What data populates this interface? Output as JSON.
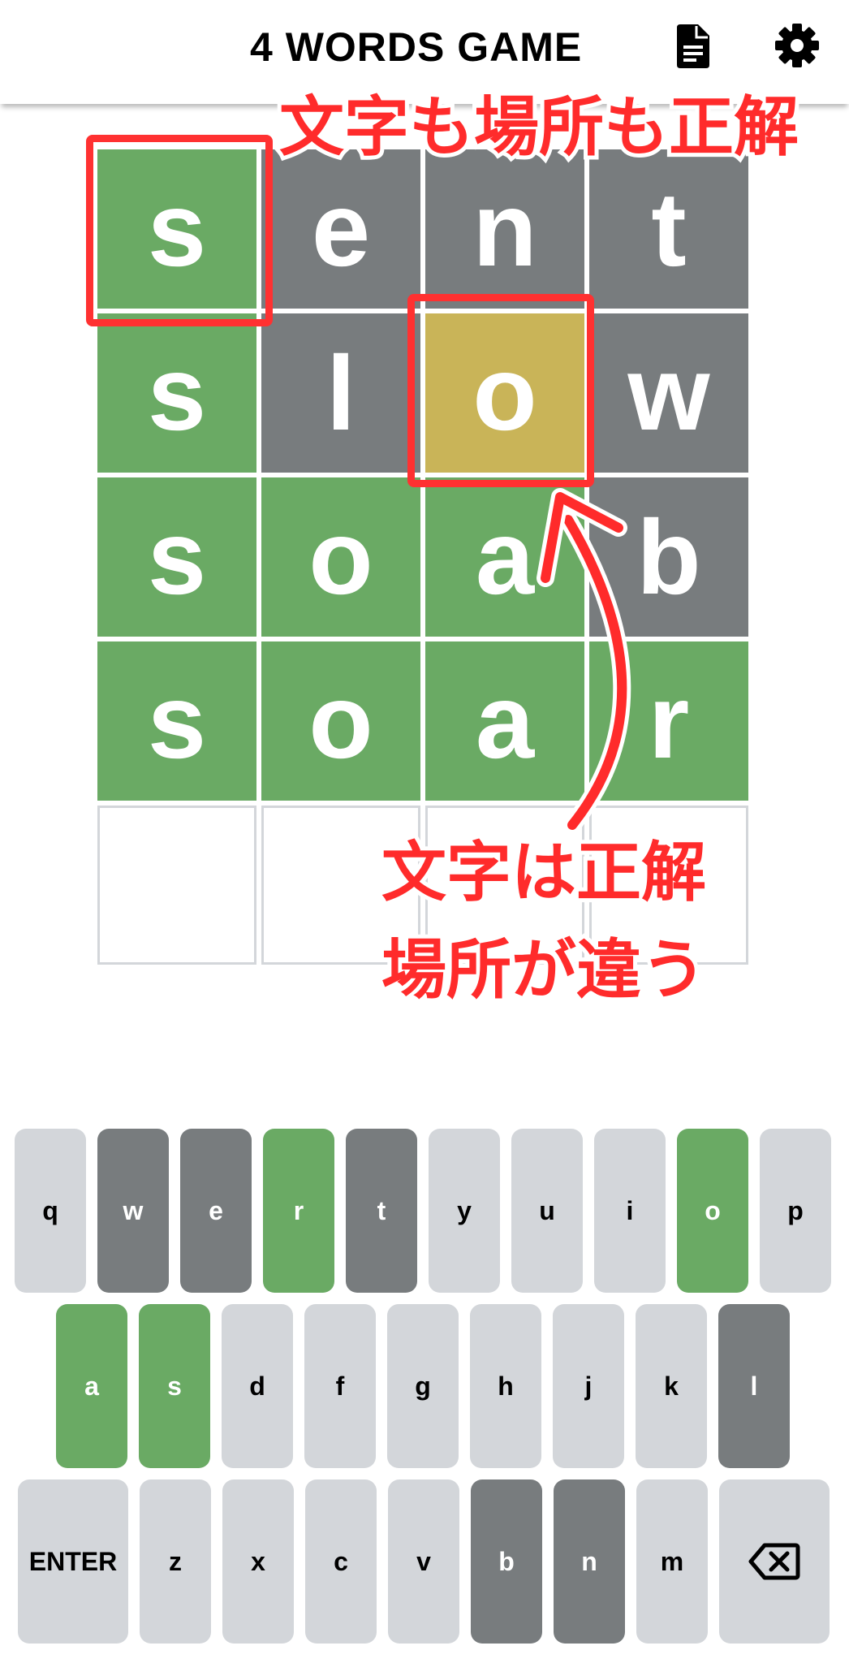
{
  "header": {
    "title": "4 WORDS GAME",
    "icons": {
      "help": "document-icon",
      "settings": "gear-icon"
    }
  },
  "board": {
    "rows": [
      [
        {
          "letter": "s",
          "state": "green"
        },
        {
          "letter": "e",
          "state": "gray"
        },
        {
          "letter": "n",
          "state": "gray"
        },
        {
          "letter": "t",
          "state": "gray"
        }
      ],
      [
        {
          "letter": "s",
          "state": "green"
        },
        {
          "letter": "l",
          "state": "gray"
        },
        {
          "letter": "o",
          "state": "yellow"
        },
        {
          "letter": "w",
          "state": "gray"
        }
      ],
      [
        {
          "letter": "s",
          "state": "green"
        },
        {
          "letter": "o",
          "state": "green"
        },
        {
          "letter": "a",
          "state": "green"
        },
        {
          "letter": "b",
          "state": "gray"
        }
      ],
      [
        {
          "letter": "s",
          "state": "green"
        },
        {
          "letter": "o",
          "state": "green"
        },
        {
          "letter": "a",
          "state": "green"
        },
        {
          "letter": "r",
          "state": "green"
        }
      ],
      [
        {
          "letter": "",
          "state": "empty"
        },
        {
          "letter": "",
          "state": "empty"
        },
        {
          "letter": "",
          "state": "empty"
        },
        {
          "letter": "",
          "state": "empty"
        }
      ]
    ]
  },
  "annotations": {
    "correct_position": "文字も場所も正解",
    "wrong_position_line1": "文字は正解",
    "wrong_position_line2": "場所が違う"
  },
  "keyboard": {
    "row1": [
      {
        "label": "q",
        "state": "default"
      },
      {
        "label": "w",
        "state": "gray"
      },
      {
        "label": "e",
        "state": "gray"
      },
      {
        "label": "r",
        "state": "green"
      },
      {
        "label": "t",
        "state": "gray"
      },
      {
        "label": "y",
        "state": "default"
      },
      {
        "label": "u",
        "state": "default"
      },
      {
        "label": "i",
        "state": "default"
      },
      {
        "label": "o",
        "state": "green"
      },
      {
        "label": "p",
        "state": "default"
      }
    ],
    "row2": [
      {
        "label": "a",
        "state": "green"
      },
      {
        "label": "s",
        "state": "green"
      },
      {
        "label": "d",
        "state": "default"
      },
      {
        "label": "f",
        "state": "default"
      },
      {
        "label": "g",
        "state": "default"
      },
      {
        "label": "h",
        "state": "default"
      },
      {
        "label": "j",
        "state": "default"
      },
      {
        "label": "k",
        "state": "default"
      },
      {
        "label": "l",
        "state": "gray"
      }
    ],
    "row3": [
      {
        "label": "ENTER",
        "state": "default"
      },
      {
        "label": "z",
        "state": "default"
      },
      {
        "label": "x",
        "state": "default"
      },
      {
        "label": "c",
        "state": "default"
      },
      {
        "label": "v",
        "state": "default"
      },
      {
        "label": "b",
        "state": "gray"
      },
      {
        "label": "n",
        "state": "gray"
      },
      {
        "label": "m",
        "state": "default"
      },
      {
        "label": "",
        "icon": "backspace-icon",
        "state": "default"
      }
    ]
  },
  "colors": {
    "green": "#6aaa64",
    "yellow": "#c9b458",
    "gray": "#787c7e",
    "key_default": "#d3d6da",
    "annotation_red": "#ff2b2b"
  }
}
